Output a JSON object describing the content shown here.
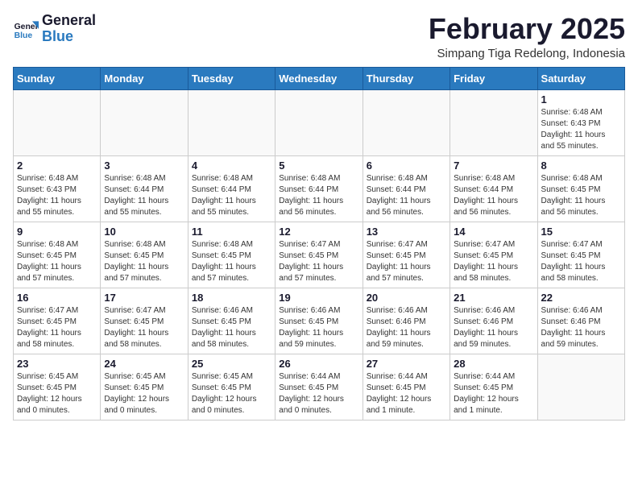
{
  "logo": {
    "general": "General",
    "blue": "Blue"
  },
  "title": "February 2025",
  "subtitle": "Simpang Tiga Redelong, Indonesia",
  "days_of_week": [
    "Sunday",
    "Monday",
    "Tuesday",
    "Wednesday",
    "Thursday",
    "Friday",
    "Saturday"
  ],
  "weeks": [
    [
      {
        "day": "",
        "info": ""
      },
      {
        "day": "",
        "info": ""
      },
      {
        "day": "",
        "info": ""
      },
      {
        "day": "",
        "info": ""
      },
      {
        "day": "",
        "info": ""
      },
      {
        "day": "",
        "info": ""
      },
      {
        "day": "1",
        "info": "Sunrise: 6:48 AM\nSunset: 6:43 PM\nDaylight: 11 hours\nand 55 minutes."
      }
    ],
    [
      {
        "day": "2",
        "info": "Sunrise: 6:48 AM\nSunset: 6:43 PM\nDaylight: 11 hours\nand 55 minutes."
      },
      {
        "day": "3",
        "info": "Sunrise: 6:48 AM\nSunset: 6:44 PM\nDaylight: 11 hours\nand 55 minutes."
      },
      {
        "day": "4",
        "info": "Sunrise: 6:48 AM\nSunset: 6:44 PM\nDaylight: 11 hours\nand 55 minutes."
      },
      {
        "day": "5",
        "info": "Sunrise: 6:48 AM\nSunset: 6:44 PM\nDaylight: 11 hours\nand 56 minutes."
      },
      {
        "day": "6",
        "info": "Sunrise: 6:48 AM\nSunset: 6:44 PM\nDaylight: 11 hours\nand 56 minutes."
      },
      {
        "day": "7",
        "info": "Sunrise: 6:48 AM\nSunset: 6:44 PM\nDaylight: 11 hours\nand 56 minutes."
      },
      {
        "day": "8",
        "info": "Sunrise: 6:48 AM\nSunset: 6:45 PM\nDaylight: 11 hours\nand 56 minutes."
      }
    ],
    [
      {
        "day": "9",
        "info": "Sunrise: 6:48 AM\nSunset: 6:45 PM\nDaylight: 11 hours\nand 57 minutes."
      },
      {
        "day": "10",
        "info": "Sunrise: 6:48 AM\nSunset: 6:45 PM\nDaylight: 11 hours\nand 57 minutes."
      },
      {
        "day": "11",
        "info": "Sunrise: 6:48 AM\nSunset: 6:45 PM\nDaylight: 11 hours\nand 57 minutes."
      },
      {
        "day": "12",
        "info": "Sunrise: 6:47 AM\nSunset: 6:45 PM\nDaylight: 11 hours\nand 57 minutes."
      },
      {
        "day": "13",
        "info": "Sunrise: 6:47 AM\nSunset: 6:45 PM\nDaylight: 11 hours\nand 57 minutes."
      },
      {
        "day": "14",
        "info": "Sunrise: 6:47 AM\nSunset: 6:45 PM\nDaylight: 11 hours\nand 58 minutes."
      },
      {
        "day": "15",
        "info": "Sunrise: 6:47 AM\nSunset: 6:45 PM\nDaylight: 11 hours\nand 58 minutes."
      }
    ],
    [
      {
        "day": "16",
        "info": "Sunrise: 6:47 AM\nSunset: 6:45 PM\nDaylight: 11 hours\nand 58 minutes."
      },
      {
        "day": "17",
        "info": "Sunrise: 6:47 AM\nSunset: 6:45 PM\nDaylight: 11 hours\nand 58 minutes."
      },
      {
        "day": "18",
        "info": "Sunrise: 6:46 AM\nSunset: 6:45 PM\nDaylight: 11 hours\nand 58 minutes."
      },
      {
        "day": "19",
        "info": "Sunrise: 6:46 AM\nSunset: 6:45 PM\nDaylight: 11 hours\nand 59 minutes."
      },
      {
        "day": "20",
        "info": "Sunrise: 6:46 AM\nSunset: 6:46 PM\nDaylight: 11 hours\nand 59 minutes."
      },
      {
        "day": "21",
        "info": "Sunrise: 6:46 AM\nSunset: 6:46 PM\nDaylight: 11 hours\nand 59 minutes."
      },
      {
        "day": "22",
        "info": "Sunrise: 6:46 AM\nSunset: 6:46 PM\nDaylight: 11 hours\nand 59 minutes."
      }
    ],
    [
      {
        "day": "23",
        "info": "Sunrise: 6:45 AM\nSunset: 6:45 PM\nDaylight: 12 hours\nand 0 minutes."
      },
      {
        "day": "24",
        "info": "Sunrise: 6:45 AM\nSunset: 6:45 PM\nDaylight: 12 hours\nand 0 minutes."
      },
      {
        "day": "25",
        "info": "Sunrise: 6:45 AM\nSunset: 6:45 PM\nDaylight: 12 hours\nand 0 minutes."
      },
      {
        "day": "26",
        "info": "Sunrise: 6:44 AM\nSunset: 6:45 PM\nDaylight: 12 hours\nand 0 minutes."
      },
      {
        "day": "27",
        "info": "Sunrise: 6:44 AM\nSunset: 6:45 PM\nDaylight: 12 hours\nand 1 minute."
      },
      {
        "day": "28",
        "info": "Sunrise: 6:44 AM\nSunset: 6:45 PM\nDaylight: 12 hours\nand 1 minute."
      },
      {
        "day": "",
        "info": ""
      }
    ]
  ]
}
